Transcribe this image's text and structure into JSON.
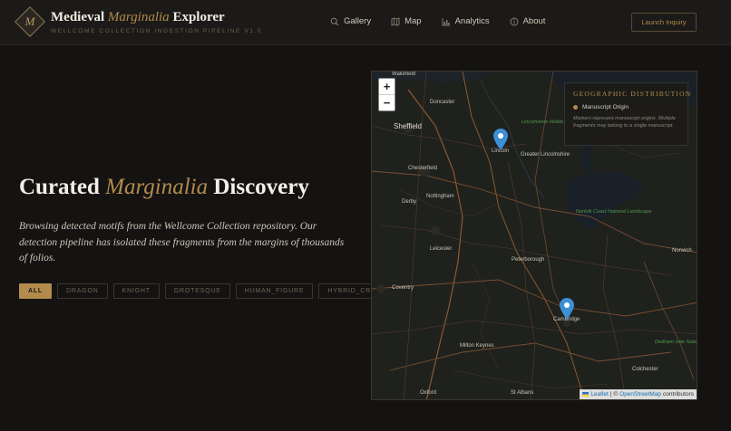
{
  "header": {
    "logo_letter": "M",
    "title_prefix": "Medieval ",
    "title_accent": "Marginalia",
    "title_suffix": " Explorer",
    "subtitle": "WELLCOME COLLECTION INGESTION PIPELINE V1.0",
    "nav": [
      {
        "label": "Gallery",
        "icon": "search-icon"
      },
      {
        "label": "Map",
        "icon": "map-icon"
      },
      {
        "label": "Analytics",
        "icon": "chart-icon"
      },
      {
        "label": "About",
        "icon": "info-icon"
      }
    ],
    "cta_label": "Launch Inquiry"
  },
  "hero": {
    "title_prefix": "Curated ",
    "title_accent": "Marginalia",
    "title_suffix": " Discovery",
    "description": "Browsing detected motifs from the Wellcome Collection repository. Our detection pipeline has isolated these fragments from the margins of thousands of folios."
  },
  "filters": [
    {
      "label": "ALL",
      "active": true
    },
    {
      "label": "DRAGON",
      "active": false
    },
    {
      "label": "KNIGHT",
      "active": false
    },
    {
      "label": "GROTESQUE",
      "active": false
    },
    {
      "label": "HUMAN_FIGURE",
      "active": false
    },
    {
      "label": "HYBRID_CREATURE",
      "active": false
    }
  ],
  "map": {
    "zoom_in": "+",
    "zoom_out": "−",
    "legend": {
      "title": "GEOGRAPHIC DISTRIBUTION",
      "item": "Manuscript Origin",
      "note": "Markers represent manuscript origins. Multiple fragments may belong to a single manuscript."
    },
    "attribution": {
      "leaflet": "Leaflet",
      "sep": "| ©",
      "osm": "OpenStreetMap",
      "suffix": "contributors"
    },
    "places": {
      "wakefield": "Wakefield",
      "doncaster": "Doncaster",
      "sheffield": "Sheffield",
      "lincoln": "Lincoln",
      "chesterfield": "Chesterfield",
      "derby": "Derby",
      "nottingham": "Nottingham",
      "leicester": "Leicester",
      "peterborough": "Peterborough",
      "norwich": "Norwich",
      "coventry": "Coventry",
      "cambridge": "Cambridge",
      "milton_keynes": "Milton Keynes",
      "oxford": "Oxford",
      "st_albans": "St Albans",
      "colchester": "Colchester",
      "greater_lincolnshire": "Greater Lincolnshire",
      "lincs_wolds": "Lincolnshire Wolds National Landscape",
      "norfolk_coast": "Norfolk Coast National Landscape",
      "dedham_vale": "Dedham Vale National Landscape"
    }
  },
  "colors": {
    "accent": "#b38b4d",
    "background": "#141312",
    "marker": "#3d8fd6"
  }
}
